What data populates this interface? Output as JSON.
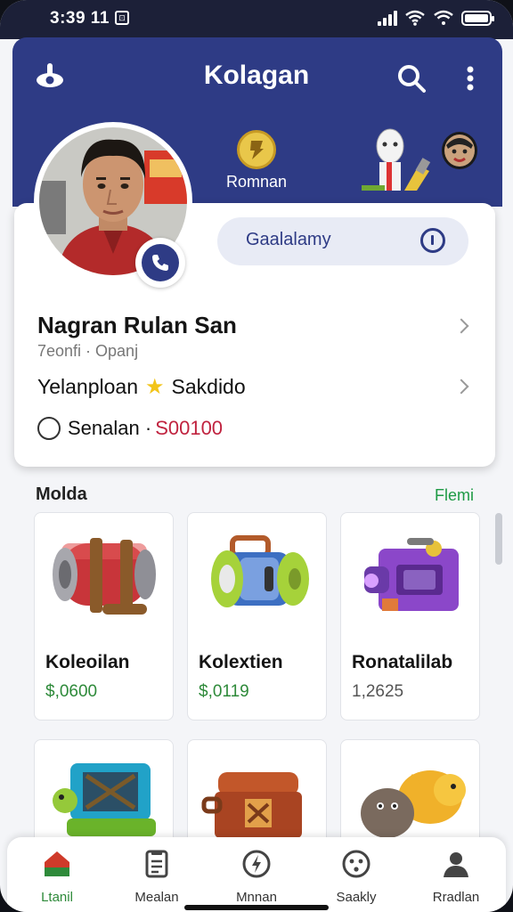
{
  "status_bar": {
    "time": "3:39 11",
    "notif": "⊡"
  },
  "header": {
    "title": "Kolagan"
  },
  "coin": {
    "label": "Romnan"
  },
  "profile": {
    "search_pill": "Gaalalamy",
    "name": "Nagran Rulan San",
    "sub": "7eonfi · Opanj",
    "level_left": "Yelanploan",
    "level_right": "Sakdido",
    "stat_label": "Senalan ·",
    "stat_value": "S00100"
  },
  "section": {
    "title": "Molda",
    "link": "Flemi"
  },
  "cards": [
    {
      "title": "Koleoilan",
      "price": "$,0600"
    },
    {
      "title": "Kolextien",
      "price": "$,0119"
    },
    {
      "title": "Ronatalilab",
      "price": "1,2625"
    }
  ],
  "nav": [
    {
      "label": "Ltanil",
      "icon": "home-icon"
    },
    {
      "label": "Mealan",
      "icon": "document-icon"
    },
    {
      "label": "Mnnan",
      "icon": "compass-icon"
    },
    {
      "label": "Saakly",
      "icon": "smiley-icon"
    },
    {
      "label": "Rradlan",
      "icon": "person-icon"
    }
  ],
  "colors": {
    "brand": "#2e3b85",
    "accent_green": "#1e9a45",
    "price_green": "#2e8a3a",
    "stat_red": "#c0233f"
  }
}
